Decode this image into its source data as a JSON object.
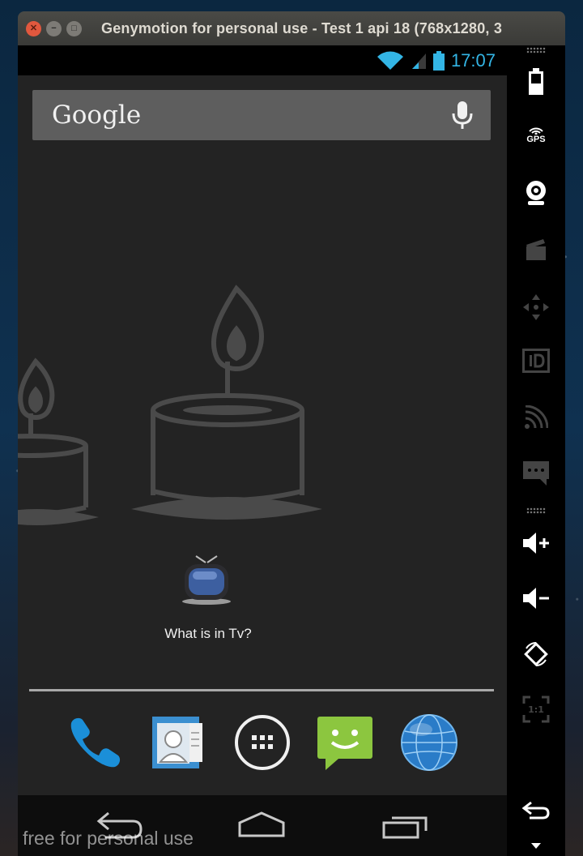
{
  "window": {
    "title": "Genymotion for personal use - Test 1 api 18 (768x1280, 3"
  },
  "status_bar": {
    "time": "17:07",
    "accent_color": "#33b5e5"
  },
  "search_bar": {
    "label": "Google",
    "mic_icon": "microphone-icon"
  },
  "home": {
    "app_label": "What is in Tv?",
    "wallpaper": "candles"
  },
  "dock": {
    "items": [
      "phone-icon",
      "contacts-icon",
      "all-apps-icon",
      "messaging-icon",
      "browser-globe-icon"
    ]
  },
  "nav": {
    "items": [
      "back-icon",
      "home-icon",
      "recents-icon"
    ]
  },
  "watermark": "free for personal use",
  "toolbar": {
    "gps_label": "GPS",
    "tools": [
      "battery-icon",
      "gps-icon",
      "webcam-icon",
      "clapperboard-icon",
      "dpad-icon",
      "id-icon",
      "cast-icon",
      "sms-icon",
      "volume-up-icon",
      "volume-down-icon",
      "rotate-icon",
      "pixel-perfect-icon",
      "back-icon",
      "menu-icon"
    ],
    "ratio_label": "1:1"
  }
}
